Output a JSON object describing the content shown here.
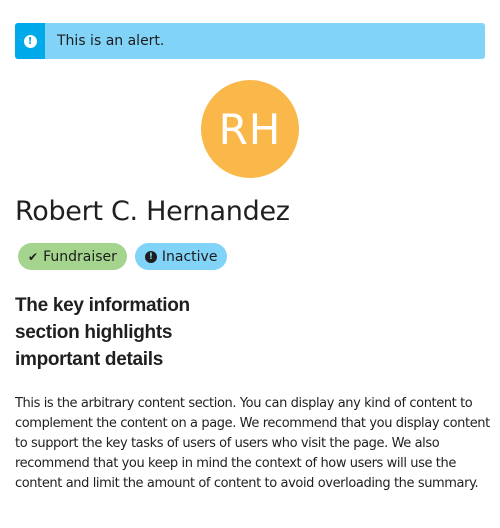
{
  "alert": {
    "icon": "exclamation-circle-icon",
    "icon_glyph": "!",
    "text": "This is an alert.",
    "color": "#81d3f7",
    "accent": "#00a9ea"
  },
  "profile": {
    "initials": "RH",
    "avatar_color": "#fbb84a",
    "name": "Robert C. Hernandez"
  },
  "badges": [
    {
      "label": "Fundraiser",
      "icon": "check-icon",
      "glyph": "✔",
      "color": "#a4d48e"
    },
    {
      "label": "Inactive",
      "icon": "exclamation-circle-icon",
      "glyph": "!",
      "color": "#81d3f7"
    }
  ],
  "key_information": {
    "heading": "The key information section highlights important details"
  },
  "content": {
    "text": "This is the arbitrary content section. You can display any kind of content to complement the content on a page. We recommend that you display content to support the key tasks of users of users who visit the page. We also recommend that you keep in mind the context of how users will use the content and limit the amount of content to avoid overloading the summary."
  }
}
